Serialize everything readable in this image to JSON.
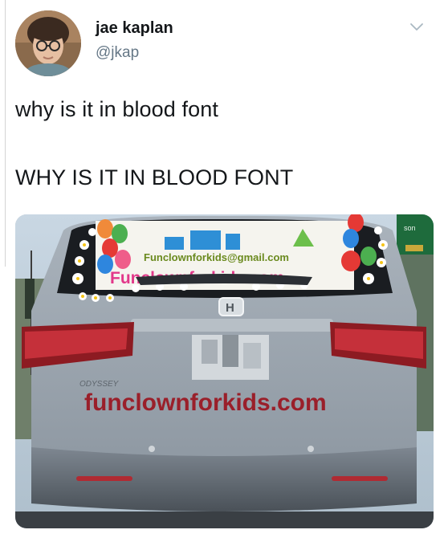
{
  "tweet": {
    "author": {
      "display_name": "jae kaplan",
      "handle": "@jkap",
      "avatar_icon": "user-avatar"
    },
    "menu_icon": "chevron-down-icon",
    "lines": [
      "why is it in blood font",
      "WHY IS IT IN BLOOD FONT"
    ],
    "media": {
      "type": "photo",
      "banner_email": "Funclownforkids@gmail.com",
      "banner_url": "Funclownforkids.com",
      "painted_text": "funclownforkids.com",
      "badge": "H",
      "sign_text": "son"
    }
  },
  "colors": {
    "text": "#14171a",
    "muted": "#657786",
    "blood": "#9a1f2a",
    "banner_pink": "#e2388a"
  }
}
